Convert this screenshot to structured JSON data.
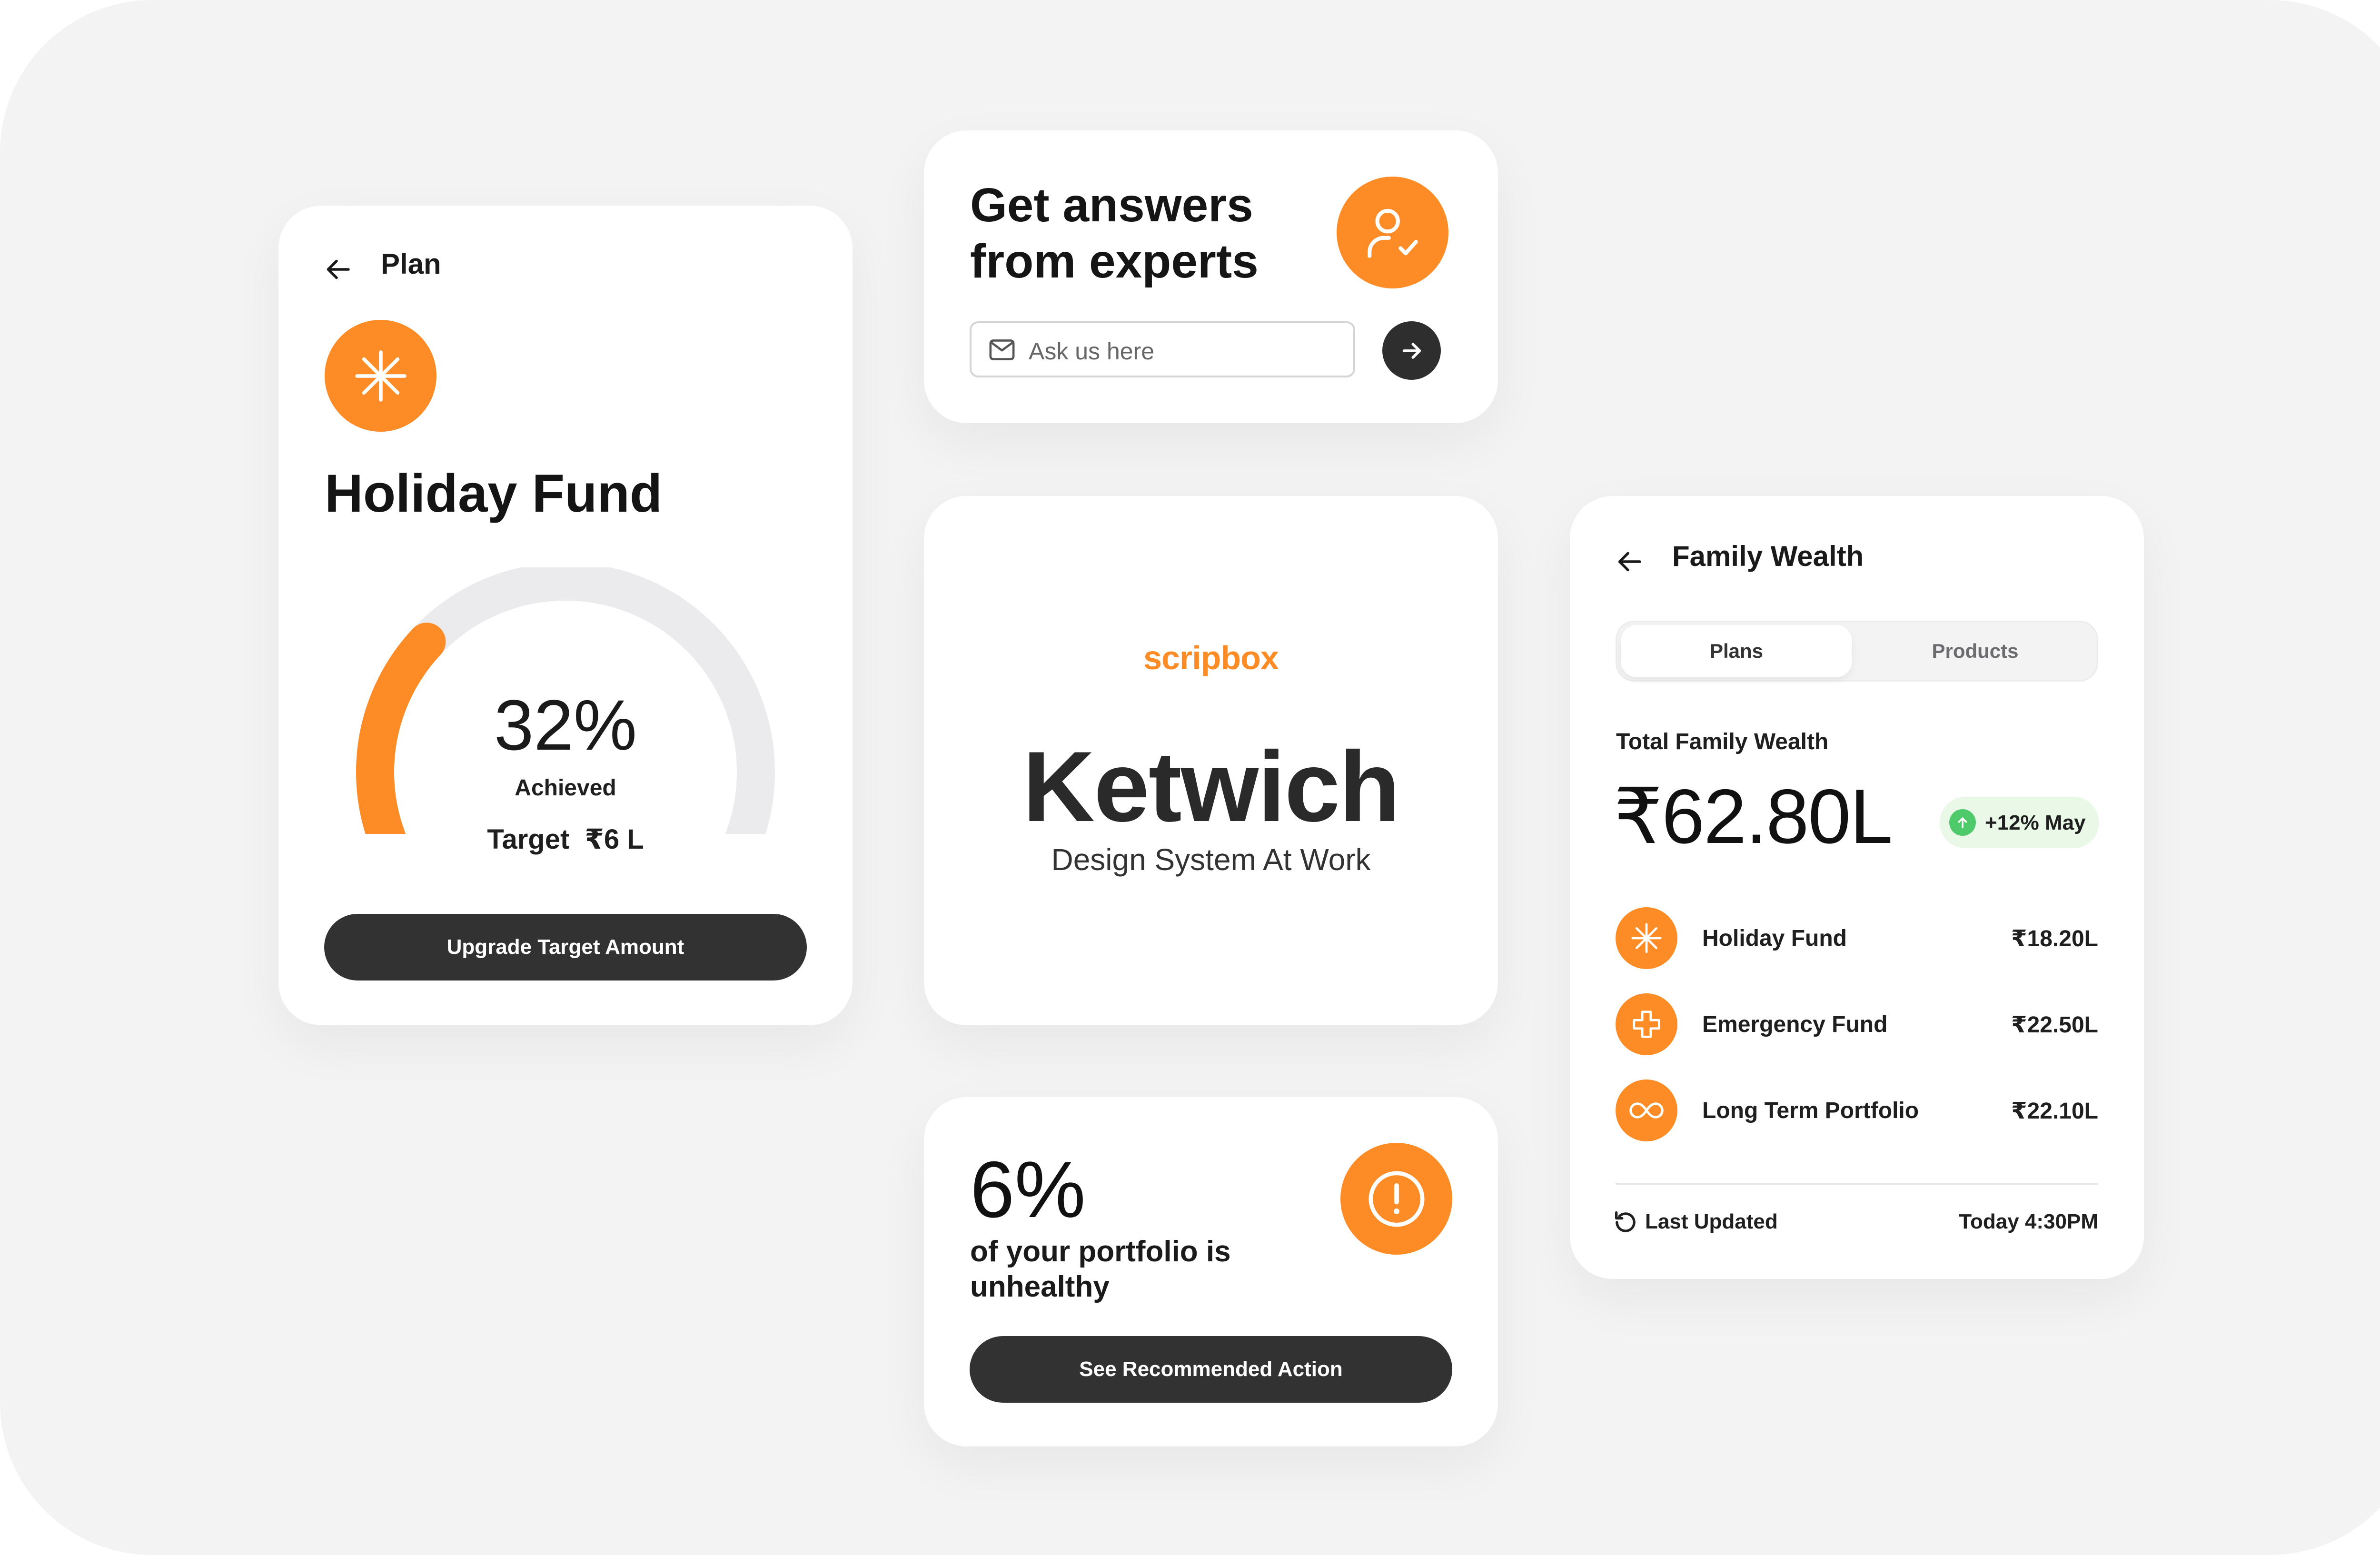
{
  "colors": {
    "accent": "#fd8c26",
    "dark_button": "#323232",
    "background": "#f3f3f3",
    "card": "#ffffff",
    "positive": "#4fca6a",
    "positive_bg": "#e9f8e7"
  },
  "plan_card": {
    "back_icon": "arrow-left-icon",
    "title": "Plan",
    "fund_icon": "asterisk-icon",
    "fund_name": "Holiday Fund",
    "progress": {
      "value": 0.32,
      "percent_label": "32%",
      "status": "Achieved",
      "target_label": "Target",
      "target_value": "₹6 L"
    },
    "button_label": "Upgrade Target Amount"
  },
  "experts_card": {
    "title_line1": "Get answers",
    "title_line2": "from experts",
    "avatar_icon": "user-check-icon",
    "input_icon": "mail-icon",
    "input_placeholder": "Ask us here",
    "send_icon": "arrow-right-icon"
  },
  "brand_card": {
    "logo_text": "scripbox",
    "name": "Ketwich",
    "tagline": "Design System At Work"
  },
  "health_card": {
    "percent": "6%",
    "message": "of your portfolio is unhealthy",
    "alert_icon": "alert-circle-icon",
    "button_label": "See Recommended Action"
  },
  "family_card": {
    "back_icon": "arrow-left-icon",
    "title": "Family Wealth",
    "tabs": [
      {
        "label": "Plans",
        "active": true
      },
      {
        "label": "Products",
        "active": false
      }
    ],
    "total_label": "Total Family Wealth",
    "total_value": "₹62.80L",
    "change": {
      "icon": "arrow-up-icon",
      "label": "+12% May"
    },
    "funds": [
      {
        "icon": "asterisk-icon",
        "name": "Holiday Fund",
        "value": "₹18.20L"
      },
      {
        "icon": "plus-icon",
        "name": "Emergency Fund",
        "value": "₹22.50L"
      },
      {
        "icon": "infinity-icon",
        "name": "Long Term Portfolio",
        "value": "₹22.10L"
      }
    ],
    "updated_icon": "refresh-icon",
    "updated_label": "Last Updated",
    "updated_value": "Today 4:30PM"
  }
}
